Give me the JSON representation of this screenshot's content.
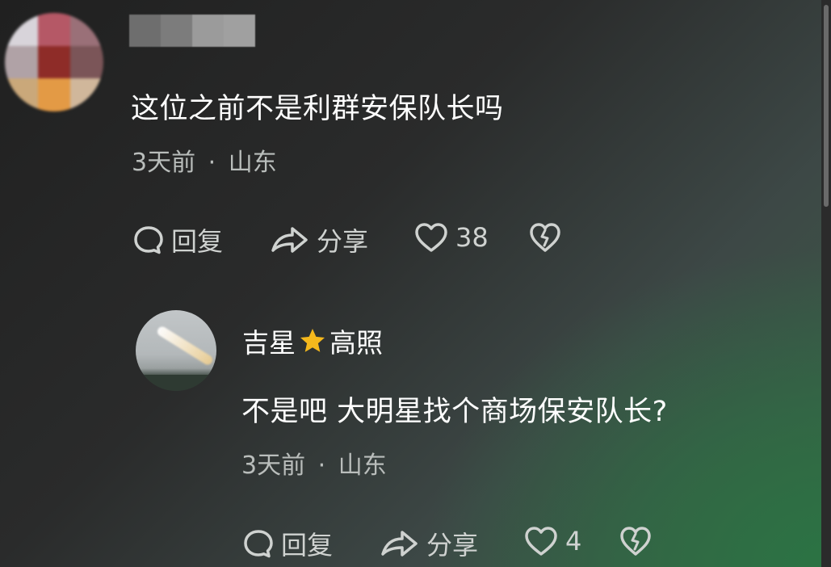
{
  "comment": {
    "text": "这位之前不是利群安保队长吗",
    "time": "3天前",
    "separator": "·",
    "location": "山东",
    "actions": {
      "reply_label": "回复",
      "share_label": "分享",
      "like_count": "38"
    }
  },
  "reply": {
    "author_part1": "吉星",
    "author_star": "star-icon",
    "author_part2": "高照",
    "text": "不是吧 大明星找个商场保安队长?",
    "time": "3天前",
    "separator": "·",
    "location": "山东",
    "actions": {
      "reply_label": "回复",
      "share_label": "分享",
      "like_count": "4"
    }
  },
  "colors": {
    "star": "#f5b81c",
    "meta_text": "#b9bdbb",
    "action_text": "#cfd2d0"
  }
}
